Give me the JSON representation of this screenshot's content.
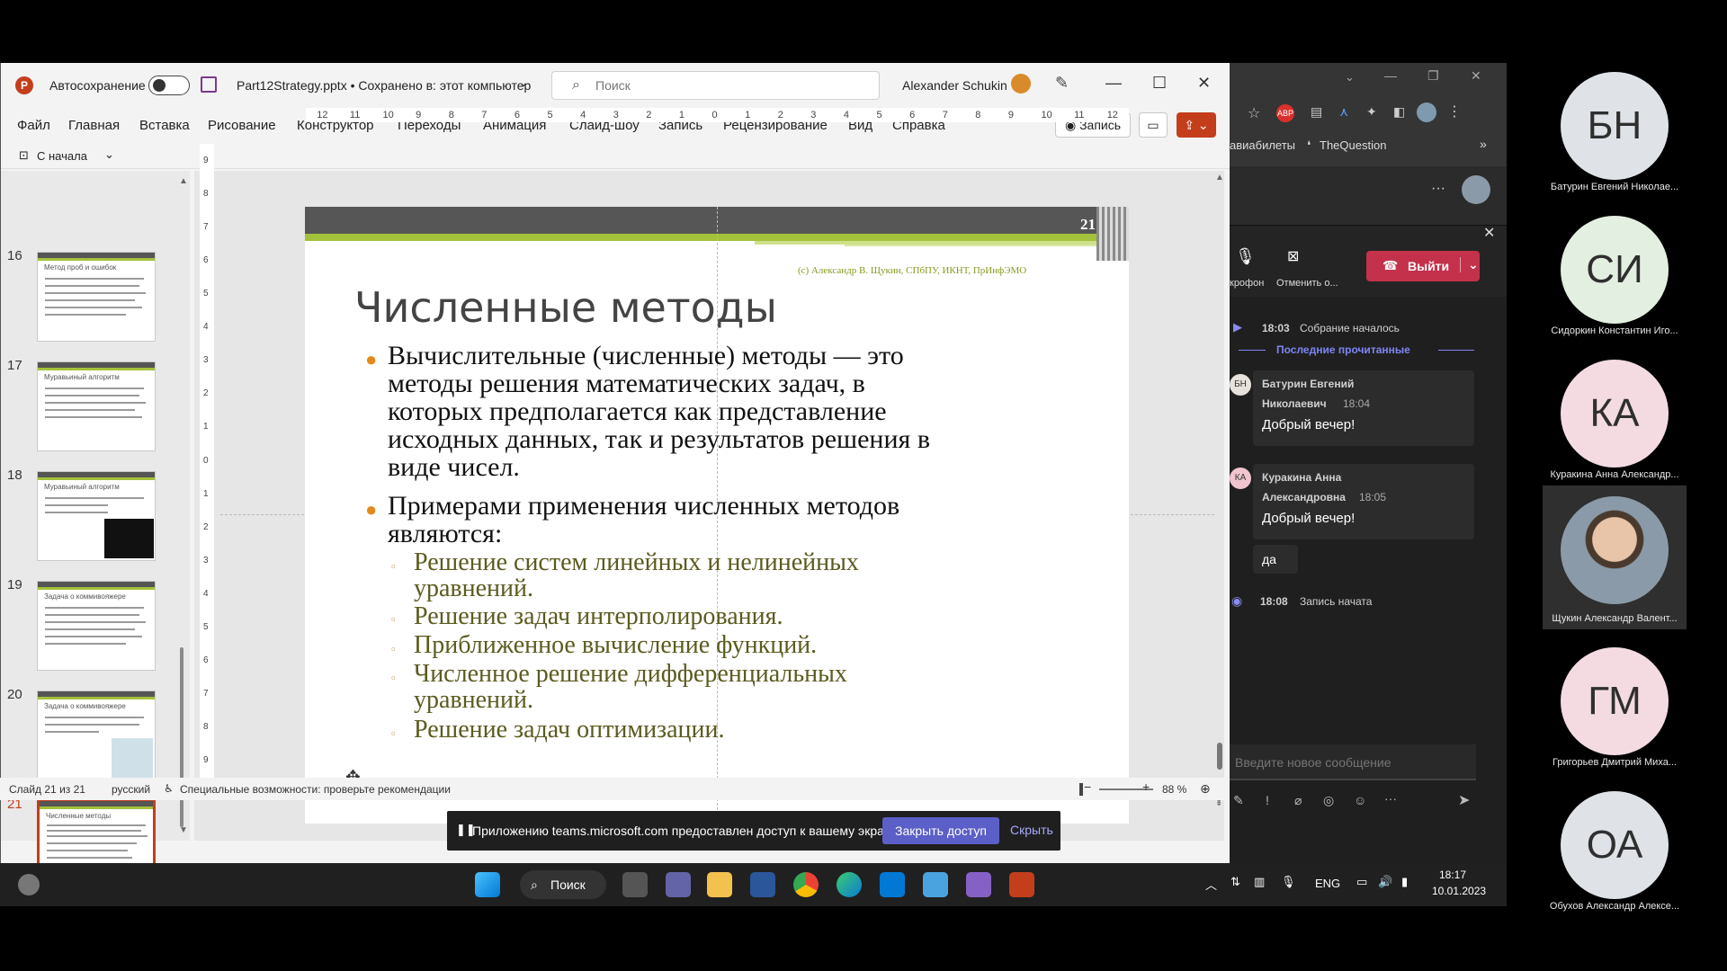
{
  "ppt": {
    "autosave_label": "Автосохранение",
    "filename": "Part12Strategy.pptx • Сохранено в: этот компьютер",
    "search_placeholder": "Поиск",
    "user_name": "Alexander Schukin",
    "menu": [
      "Файл",
      "Главная",
      "Вставка",
      "Рисование",
      "Конструктор",
      "Переходы",
      "Анимация",
      "Слайд-шоу",
      "Запись",
      "Рецензирование",
      "Вид",
      "Справка"
    ],
    "record_btn": "Запись",
    "from_start": "С начала",
    "ruler_h": [
      "12",
      "11",
      "10",
      "9",
      "8",
      "7",
      "6",
      "5",
      "4",
      "3",
      "2",
      "1",
      "0",
      "1",
      "2",
      "3",
      "4",
      "5",
      "6",
      "7",
      "8",
      "9",
      "10",
      "11",
      "12"
    ],
    "ruler_v": [
      "9",
      "8",
      "7",
      "6",
      "5",
      "4",
      "3",
      "2",
      "1",
      "0",
      "1",
      "2",
      "3",
      "4",
      "5",
      "6",
      "7",
      "8",
      "9"
    ],
    "thumb_numbers": [
      "16",
      "17",
      "18",
      "19",
      "20",
      "21"
    ],
    "thumb_titles": [
      "Метод проб и ошибок",
      "Муравьиный алгоритм",
      "Муравьиный алгоритм",
      "Задача о коммивояжере",
      "Задача о коммивояжере",
      "Численные методы"
    ],
    "status": {
      "slide": "Слайд 21 из 21",
      "lang": "русский",
      "accessibility": "Специальные возможности: проверьте рекомендации",
      "zoom": "88 %"
    }
  },
  "slide": {
    "number": "21",
    "copyright": "(с) Александр В. Щукин, СПбПУ, ИКНТ, ПрИнфЭМО",
    "title": "Численные методы",
    "bullet1": [
      "Вычислительные (численные) методы — это",
      "методы решения математических задач, в",
      "которых предполагается как представление",
      "исходных данных, так и результатов решения в",
      "виде чисел."
    ],
    "bullet2": [
      "Примерами применения численных методов",
      "являются:"
    ],
    "sub": [
      [
        "Решение систем линейных и нелинейных",
        "уравнений."
      ],
      [
        "Решение задач интерполирования."
      ],
      [
        "Приближенное вычисление функций."
      ],
      [
        "Численное решение дифференциальных",
        "уравнений."
      ],
      [
        "Решение задач оптимизации."
      ]
    ]
  },
  "share_notice": {
    "text": "Приложению teams.microsoft.com предоставлен доступ к вашему экрану.",
    "close_btn": "Закрыть доступ",
    "hide": "Скрыть"
  },
  "taskbar": {
    "search": "Поиск",
    "lang": "ENG",
    "time": "18:17",
    "date": "10.01.2023"
  },
  "browser": {
    "bookmarks": [
      "авиабилеты",
      "TheQuestion"
    ],
    "mic_label": "крофон",
    "cancel_label": "Отменить о...",
    "leave_btn": "Выйти",
    "events": [
      {
        "time": "18:03",
        "text": "Собрание началось"
      },
      {
        "time": "18:08",
        "text": "Запись начата"
      }
    ],
    "last_read": "Последние прочитанные",
    "messages": [
      {
        "initials": "БН",
        "name1": "Батурин Евгений",
        "name2": "Николаевич",
        "time": "18:04",
        "text": "Добрый вечер!"
      },
      {
        "initials": "КА",
        "name1": "Куракина Анна",
        "name2": "Александровна",
        "time": "18:05",
        "text": "Добрый вечер!",
        "extra": "да"
      }
    ],
    "compose_placeholder": "Введите новое сообщение"
  },
  "participants": [
    {
      "initials": "БН",
      "name": "Батурин Евгений Николае...",
      "bg": "#dfe3e8"
    },
    {
      "initials": "СИ",
      "name": "Сидоркин Константин Иго...",
      "bg": "#e3efe0"
    },
    {
      "initials": "КА",
      "name": "Куракина Анна Александр...",
      "bg": "#f4dbe2"
    },
    {
      "initials": "",
      "name": "Щукин Александр Валент...",
      "bg": "#6d7c86"
    },
    {
      "initials": "ГМ",
      "name": "Григорьев Дмитрий Миха...",
      "bg": "#f4dbe2"
    },
    {
      "initials": "ОА",
      "name": "Обухов Александр Алексе...",
      "bg": "#dfe3e8"
    }
  ]
}
